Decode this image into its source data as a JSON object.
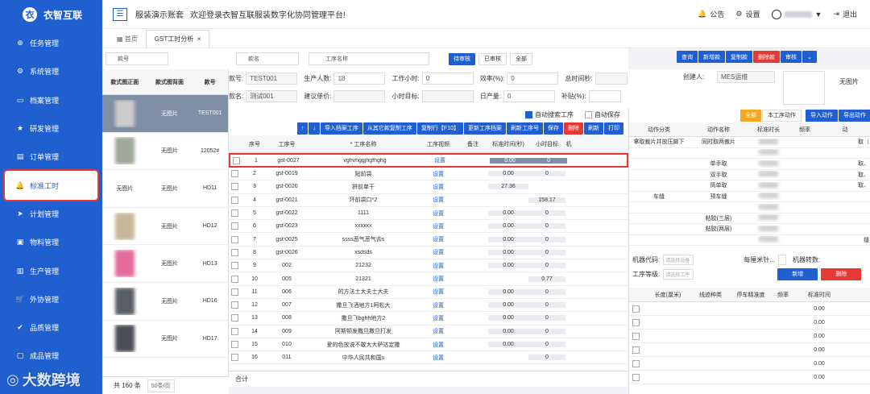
{
  "app": {
    "name": "衣智互联",
    "logo": "衣"
  },
  "nav": [
    {
      "label": "任务管理",
      "icon": "plus-circle-icon"
    },
    {
      "label": "系统管理",
      "icon": "gear-icon"
    },
    {
      "label": "档案管理",
      "icon": "monitor-icon"
    },
    {
      "label": "研发管理",
      "icon": "star-icon"
    },
    {
      "label": "订单管理",
      "icon": "document-icon"
    },
    {
      "label": "标准工时",
      "icon": "bell-icon",
      "active": true
    },
    {
      "label": "计划管理",
      "icon": "send-icon"
    },
    {
      "label": "物料管理",
      "icon": "box-icon"
    },
    {
      "label": "生产管理",
      "icon": "factory-icon"
    },
    {
      "label": "外协管理",
      "icon": "cart-icon"
    },
    {
      "label": "品质管理",
      "icon": "check-circle-icon"
    },
    {
      "label": "成品管理",
      "icon": "bag-icon"
    }
  ],
  "topbar": {
    "account": "服装演示账套",
    "welcome": "欢迎登录衣智互联服装数字化协同管理平台!",
    "notice": "公告",
    "settings": "设置",
    "logout": "退出"
  },
  "tabs": [
    {
      "label": "首页"
    },
    {
      "label": "GST工时分析",
      "active": true
    }
  ],
  "filter": {
    "style_label": "款号",
    "name_label": "款名",
    "proc_label": "工序名称",
    "audit_pending": "待审核",
    "audited": "已审核",
    "all": "全部"
  },
  "top_buttons": [
    "查询",
    "新增款",
    "复制款",
    "删除款",
    "审核"
  ],
  "left_grid": {
    "headers": [
      "款式图正面",
      "款式图背面",
      "款号"
    ],
    "rows": [
      {
        "front": "",
        "back": "无图片",
        "code": "TEST001",
        "selected": true
      },
      {
        "front": "",
        "back": "无图片",
        "code": "12052#"
      },
      {
        "front": "无图片",
        "back": "无图片",
        "code": "HD11"
      },
      {
        "front": "",
        "back": "无图片",
        "code": "HD12"
      },
      {
        "front": "",
        "back": "无图片",
        "code": "HD13"
      },
      {
        "front": "",
        "back": "无图片",
        "code": "HD16"
      },
      {
        "front": "",
        "back": "无图片",
        "code": "HD17"
      }
    ],
    "total": "共 160 条",
    "pagesize": "50条/页"
  },
  "form": {
    "code_k": "款号:",
    "code_v": "TEST001",
    "people_k": "生产人数:",
    "people_v": "18",
    "hours_k": "工作小时:",
    "hours_v": "0",
    "eff_k": "效率(%):",
    "eff_v": "0",
    "total_k": "总时间秒:",
    "name_k": "款名:",
    "name_v": "测试001",
    "price_k": "建议单价:",
    "target_k": "小时目标:",
    "output_k": "日产量:",
    "output_v": "0",
    "subsidy_k": "补贴(%):",
    "creator_k": "创建人:",
    "creator_v": "MES运维",
    "nopic": "无图片"
  },
  "options": {
    "auto_search": "自动搜索工序",
    "auto_save": "自动保存"
  },
  "toolbar": [
    "↑",
    "↓",
    "导入档案工序",
    "从其它款复制工序",
    "复制行【F10】",
    "更新工序档案",
    "刷新工序号",
    "保存",
    "删除",
    "刷新",
    "打印"
  ],
  "grid": {
    "headers": [
      "",
      "序号",
      "工序号",
      "* 工序名称",
      "工序视频",
      "备注",
      "标准时间(秒)",
      "小时目标",
      "机"
    ],
    "rows": [
      {
        "no": "1",
        "code": "gst-0027",
        "name": "vghvhggjhgfhghg",
        "video": "设置",
        "remark": "",
        "std": "0.00",
        "target": "0"
      },
      {
        "no": "2",
        "code": "gst-0019",
        "name": "贴前袋",
        "video": "设置",
        "remark": "",
        "std": "0.00",
        "target": "0"
      },
      {
        "no": "3",
        "code": "gst-0020",
        "name": "拼前单干",
        "video": "设置",
        "remark": "",
        "std": "27.36",
        "target": ""
      },
      {
        "no": "4",
        "code": "gst-0021",
        "name": "环前袋口*2",
        "video": "设置",
        "remark": "",
        "std": "",
        "target": "158.17"
      },
      {
        "no": "5",
        "code": "gst-0022",
        "name": "1111",
        "video": "设置",
        "remark": "",
        "std": "0.00",
        "target": "0"
      },
      {
        "no": "6",
        "code": "gst-0023",
        "name": "xxxxxx",
        "video": "设置",
        "remark": "",
        "std": "0.00",
        "target": "0"
      },
      {
        "no": "7",
        "code": "gst-0025",
        "name": "ssss恶气恶气去s",
        "video": "设置",
        "remark": "",
        "std": "0.00",
        "target": "0"
      },
      {
        "no": "8",
        "code": "gst-0026",
        "name": "xsdsds",
        "video": "设置",
        "remark": "",
        "std": "0.00",
        "target": "0"
      },
      {
        "no": "9",
        "code": "002",
        "name": "21232",
        "video": "设置",
        "remark": "",
        "std": "0.00",
        "target": "0"
      },
      {
        "no": "10",
        "code": "005",
        "name": "21321",
        "video": "设置",
        "remark": "",
        "std": "",
        "target": "0.77"
      },
      {
        "no": "11",
        "code": "006",
        "name": "的方法士大夫士大夫",
        "video": "设置",
        "remark": "",
        "std": "0.00",
        "target": "0"
      },
      {
        "no": "12",
        "code": "007",
        "name": "撒旦飞洒地方1阿松大",
        "video": "设置",
        "remark": "",
        "std": "0.00",
        "target": "0"
      },
      {
        "no": "13",
        "code": "008",
        "name": "撒旦飞bghh地方2",
        "video": "设置",
        "remark": "",
        "std": "0.00",
        "target": "0"
      },
      {
        "no": "14",
        "code": "009",
        "name": "阿斯顿发撒旦撒旦打发",
        "video": "设置",
        "remark": "",
        "std": "0.00",
        "target": "0"
      },
      {
        "no": "15",
        "code": "010",
        "name": "爱的色放说不敢大大萨达定撒",
        "video": "设置",
        "remark": "",
        "std": "0.00",
        "target": "0"
      },
      {
        "no": "16",
        "code": "011",
        "name": "中华人民共和国s",
        "video": "设置",
        "remark": "",
        "std": "",
        "target": "0"
      }
    ],
    "sum": "合计"
  },
  "right": {
    "tabs": [
      "全部",
      "本工序动作",
      "导入动作",
      "导出动作"
    ],
    "headers": [
      "动作分类",
      "动作名称",
      "标准时长",
      "频率",
      "动"
    ],
    "rows": [
      {
        "cat": "拿取裁片并放压脚下",
        "name": "同时取两裁片",
        "extra": "取（"
      },
      {
        "cat": "",
        "name": "",
        "extra": ""
      },
      {
        "cat": "",
        "name": "单手取",
        "extra": "取、"
      },
      {
        "cat": "",
        "name": "双手取",
        "extra": "取、"
      },
      {
        "cat": "",
        "name": "简单取",
        "extra": "取、"
      },
      {
        "cat": "车缝",
        "name": "预车缝",
        "extra": ""
      },
      {
        "cat": "",
        "name": "",
        "extra": ""
      },
      {
        "cat": "",
        "name": "粘胶(三层)",
        "extra": ""
      },
      {
        "cat": "",
        "name": "粘胶(两层)",
        "extra": ""
      },
      {
        "cat": "",
        "name": "",
        "extra": "缝"
      }
    ],
    "machine_code": "机器代码:",
    "stitch": "每厘米针...",
    "machine_speed": "机器转数:",
    "level": "工序等级:",
    "placeholder": "请选择设备",
    "placeholder2": "请选择工序",
    "add": "新增",
    "delete": "删除",
    "bheaders": [
      "",
      "长度(厘米)",
      "线迹种类",
      "停车精准度",
      "频率",
      "标准时间"
    ],
    "brows": [
      "0.00",
      "0.00",
      "0.00",
      "0.00",
      "0.00",
      "0.00"
    ]
  },
  "watermark": "大数跨境"
}
